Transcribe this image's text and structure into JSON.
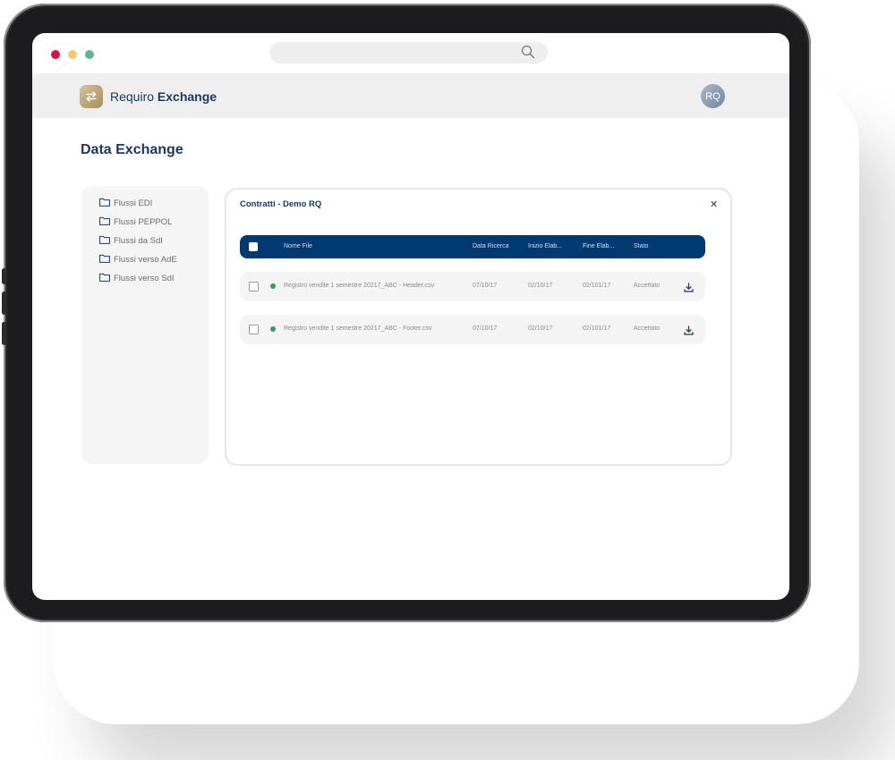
{
  "browser": {
    "dots": [
      "#e0103c",
      "#f5c86a",
      "#5fb88a"
    ],
    "search_icon": "search-icon"
  },
  "app": {
    "name_regular": "Requiro",
    "name_bold": "Exchange",
    "logo_icon": "arrows-exchange-icon",
    "user_initials": "RQ"
  },
  "page": {
    "title": "Data Exchange"
  },
  "sidebar": {
    "items": [
      {
        "label": "Flussi EDI",
        "icon": "folder-icon"
      },
      {
        "label": "Flussi PEPPOL",
        "icon": "folder-icon"
      },
      {
        "label": "Flussi da SdI",
        "icon": "folder-icon"
      },
      {
        "label": "Flussi verso AdE",
        "icon": "folder-icon"
      },
      {
        "label": "Flussi verso SdI",
        "icon": "folder-icon"
      }
    ]
  },
  "panel": {
    "title": "Contratti - Demo RQ",
    "close_icon": "close-icon",
    "columns": {
      "name": "Nome File",
      "search_date": "Data Ricerca",
      "start": "Inizio Elab...",
      "end": "Fine Elab...",
      "status": "Stato"
    },
    "rows": [
      {
        "name": "Registro vendite 1 semestre 20217_ABC - Header.csv",
        "search_date": "07/10/17",
        "start": "02/10/17",
        "end": "02/101/17",
        "status": "Accettato",
        "status_color": "#2e9e5e"
      },
      {
        "name": "Registro vendite 1 semestre 20217_ABC - Footer.csv",
        "search_date": "07/10/17",
        "start": "02/10/17",
        "end": "02/101/17",
        "status": "Accettato",
        "status_color": "#2e9e5e"
      }
    ]
  },
  "colors": {
    "primary": "#003a70",
    "title": "#1a3a63",
    "success": "#2e9e5e"
  }
}
